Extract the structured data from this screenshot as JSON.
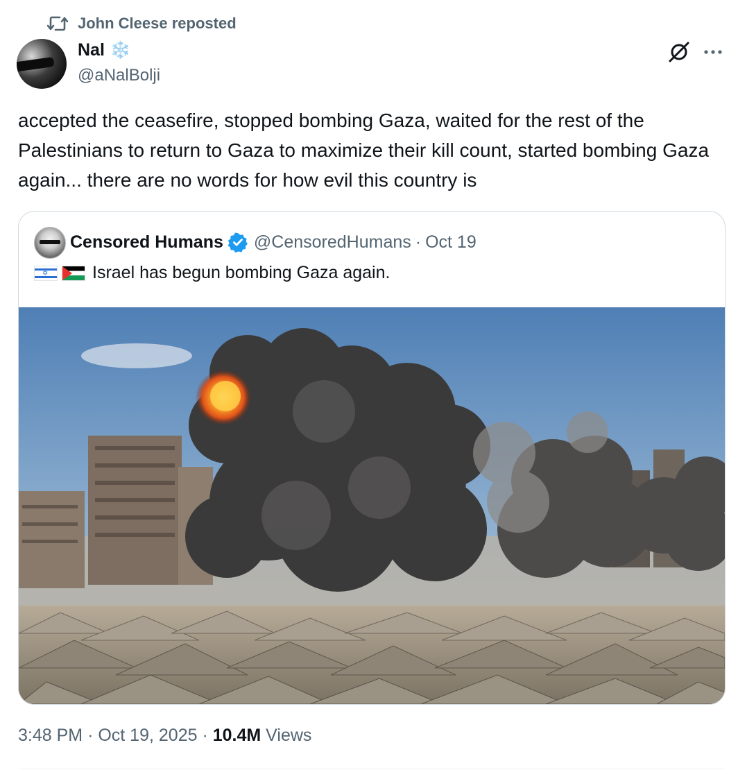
{
  "repost": {
    "label": "John Cleese reposted"
  },
  "author": {
    "name": "Nal",
    "emoji": "❄️",
    "handle": "@aNalBolji"
  },
  "tweet": {
    "text": "accepted the ceasefire, stopped bombing Gaza, waited for the rest of the Palestinians to return to Gaza to maximize their kill count, started bombing Gaza again... there are no words for how evil this country is"
  },
  "quote": {
    "name": "Censored Humans",
    "handle": "@CensoredHumans",
    "sep": "·",
    "date": "Oct 19",
    "text": "Israel has begun bombing Gaza again."
  },
  "meta": {
    "time": "3:48 PM",
    "sep1": "·",
    "date": "Oct 19, 2025",
    "sep2": "·",
    "views_count": "10.4M",
    "views_label": "Views"
  },
  "colors": {
    "secondary_text": "#536471",
    "primary_text": "#0f1419",
    "verified": "#1d9bf0",
    "border": "#cfd9de"
  },
  "icons": [
    "repost-icon",
    "grok-icon",
    "more-icon",
    "verified-badge-icon"
  ]
}
